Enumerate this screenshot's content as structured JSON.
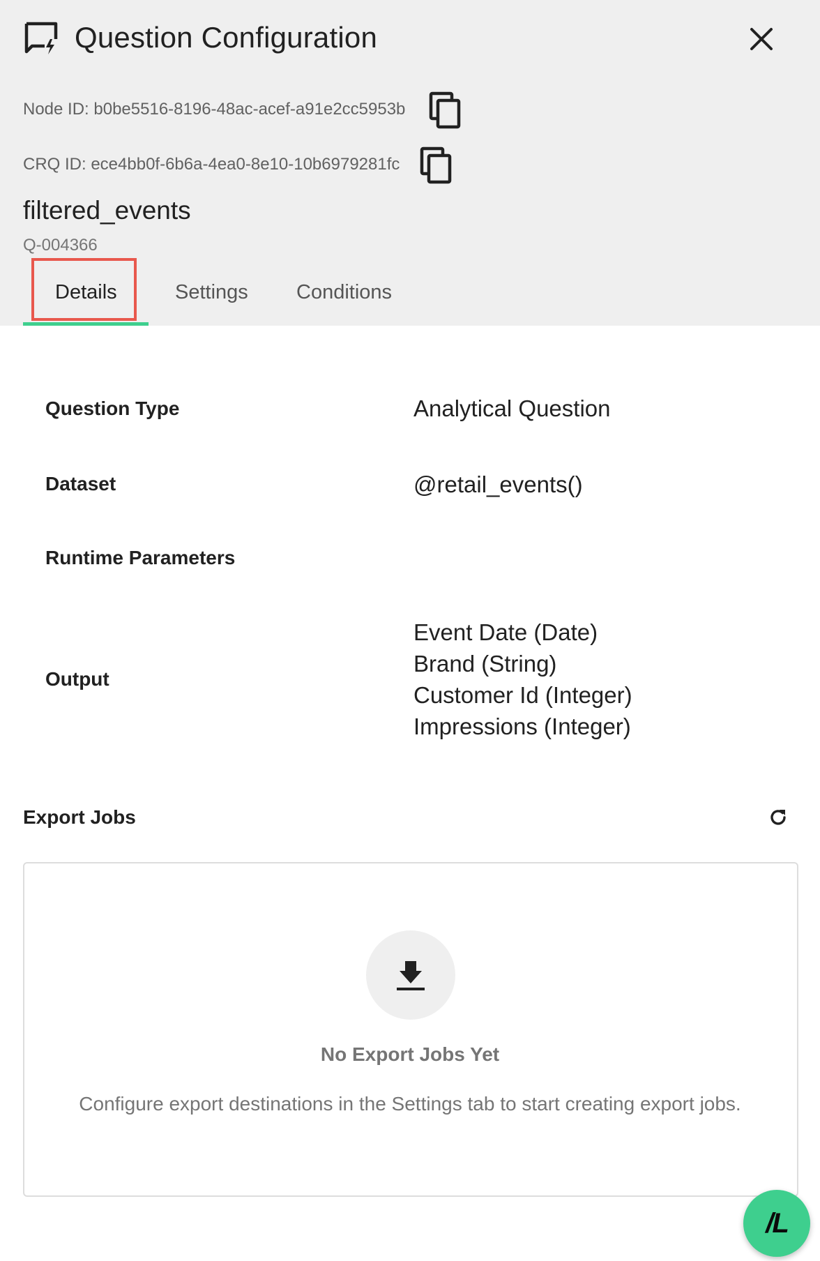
{
  "header": {
    "title": "Question Configuration",
    "node_id": "Node ID: b0be5516-8196-48ac-acef-a91e2cc5953b",
    "crq_id": "CRQ ID: ece4bb0f-6b6a-4ea0-8e10-10b6979281fc",
    "name": "filtered_events",
    "qid": "Q-004366",
    "icons": {
      "title": "chat-bolt-icon",
      "close": "close-icon",
      "copy": "copy-icon"
    }
  },
  "tabs": [
    {
      "label": "Details",
      "active": true
    },
    {
      "label": "Settings",
      "active": false
    },
    {
      "label": "Conditions",
      "active": false
    }
  ],
  "details": {
    "question_type_label": "Question Type",
    "question_type_value": "Analytical Question",
    "dataset_label": "Dataset",
    "dataset_value": "@retail_events()",
    "runtime_label": "Runtime Parameters",
    "output_label": "Output",
    "outputs": [
      "Event Date (Date)",
      "Brand (String)",
      "Customer Id (Integer)",
      "Impressions (Integer)"
    ]
  },
  "export_jobs": {
    "title": "Export Jobs",
    "empty_title": "No Export Jobs Yet",
    "empty_description": "Configure export destinations in the Settings tab to start creating export jobs.",
    "icons": {
      "refresh": "refresh-icon",
      "download": "download-icon"
    }
  },
  "fab": {
    "label": "/L"
  },
  "colors": {
    "accent": "#3ecf8e",
    "highlight": "#e8584d",
    "header_bg": "#efefef"
  }
}
